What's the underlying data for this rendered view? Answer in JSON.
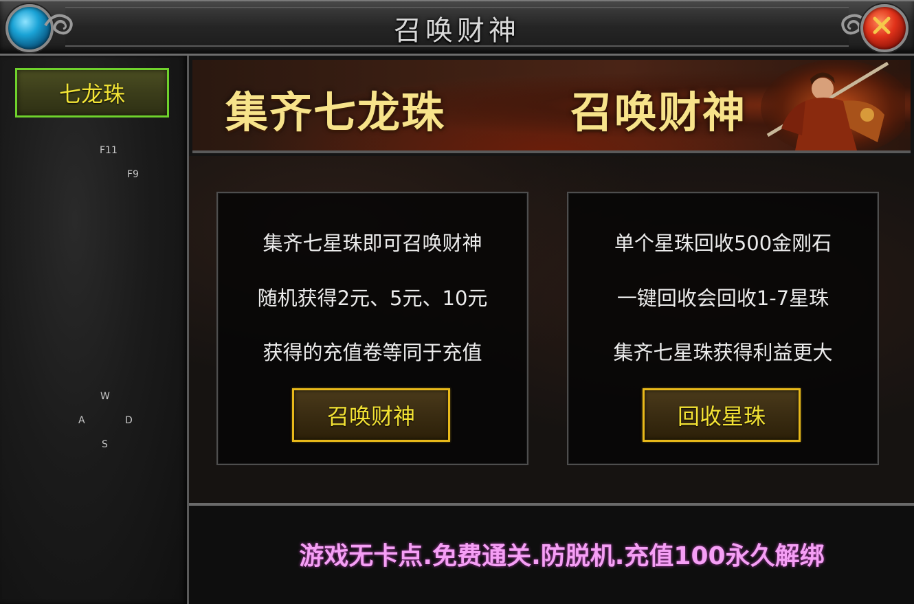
{
  "window": {
    "title": "召唤财神"
  },
  "sidebar": {
    "tab_label": "七龙珠",
    "key_hints": {
      "f11": "F11",
      "f9": "F9",
      "w": "W",
      "a": "A",
      "d": "D",
      "s": "S"
    }
  },
  "banner": {
    "left_text": "集齐七龙珠",
    "right_text": "召唤财神"
  },
  "left_panel": {
    "lines": [
      "集齐七星珠即可召唤财神",
      "随机获得2元、5元、10元",
      "获得的充值卷等同于充值"
    ],
    "button_label": "召唤财神"
  },
  "right_panel": {
    "lines": [
      "单个星珠回收500金刚石",
      "一键回收会回收1-7星珠",
      "集齐七星珠获得利益更大"
    ],
    "button_label": "回收星珠"
  },
  "footer": {
    "text": "游戏无卡点.免费通关.防脱机.充值100永久解绑"
  },
  "colors": {
    "tab_text": "#f2e436",
    "tab_border": "#6fd22c",
    "button_border": "#e8b91a",
    "footer_text": "#f59ff5",
    "banner_text": "#f7e38a"
  }
}
